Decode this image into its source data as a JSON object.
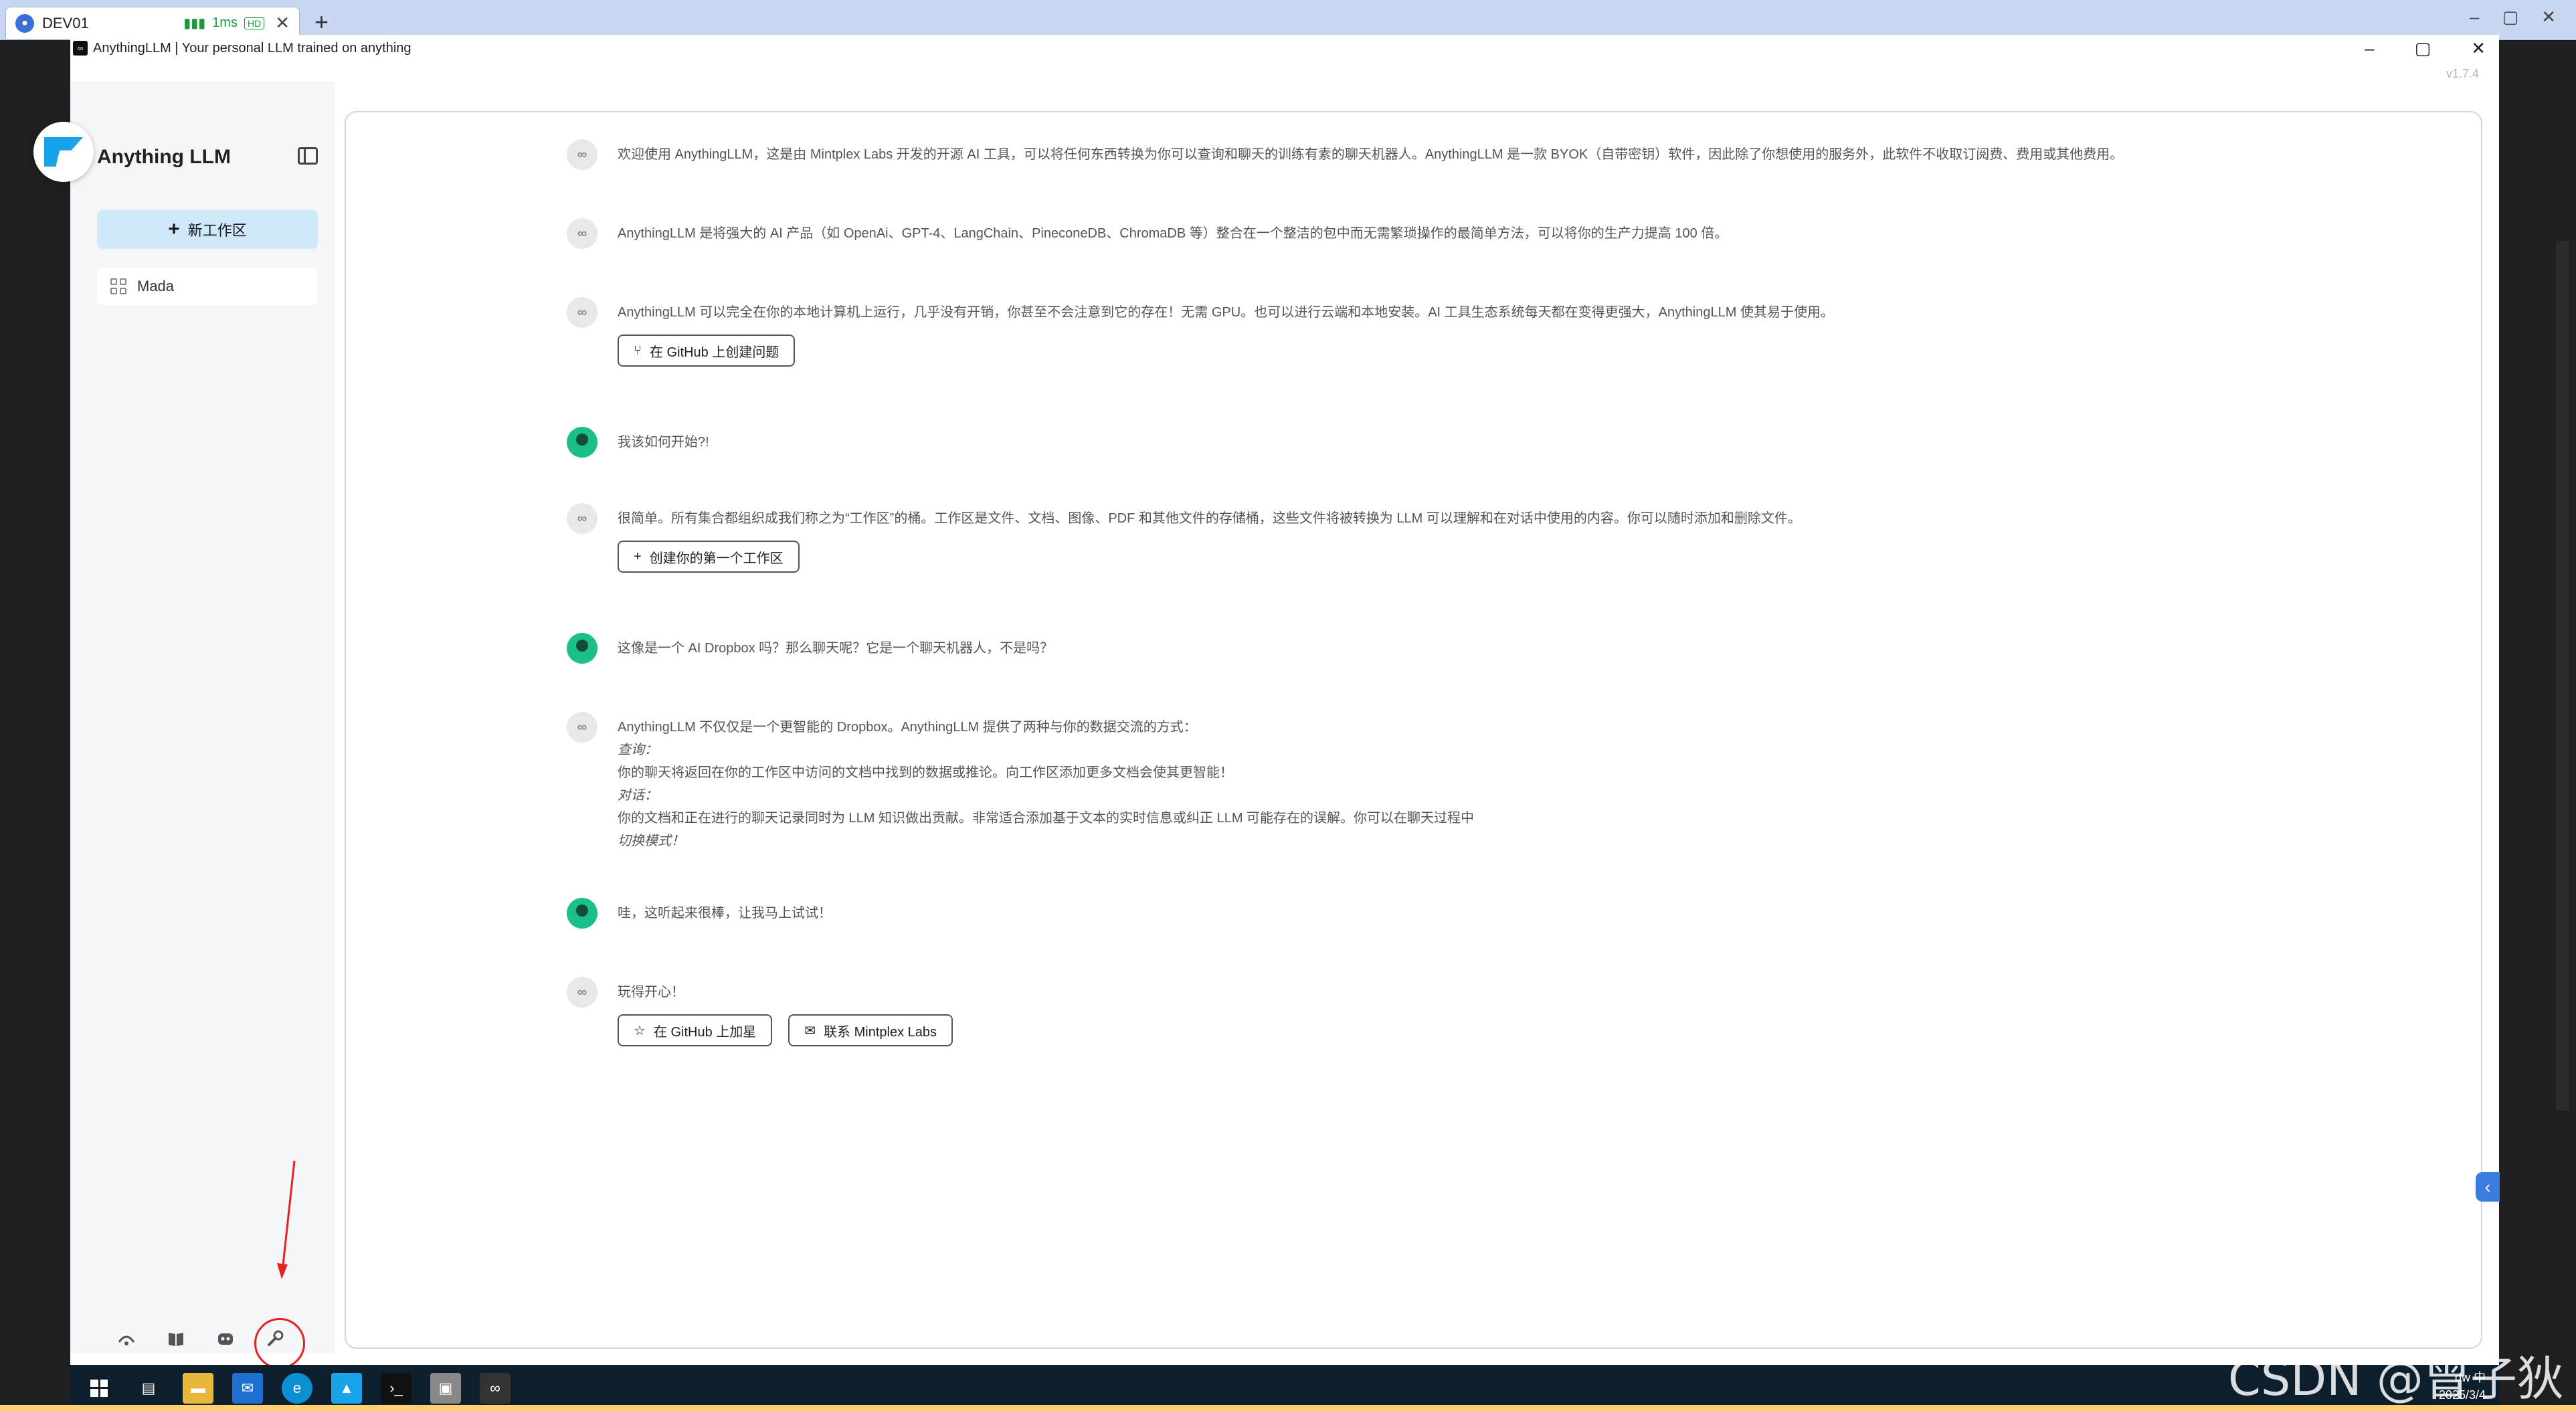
{
  "remote": {
    "tab_label": "DEV01",
    "latency": "1ms",
    "quality": "HD",
    "close": "✕",
    "new_tab": "+"
  },
  "window": {
    "title": "AnythingLLM | Your personal LLM trained on anything",
    "version": "v1.7.4",
    "min": "–",
    "max": "▢",
    "close": "✕"
  },
  "sidebar": {
    "brand": "Anything LLM",
    "new_workspace": "新工作区",
    "workspaces": [
      {
        "label": "Mada"
      }
    ],
    "footer_icons": [
      "community-hub-icon",
      "docs-book-icon",
      "discord-icon",
      "settings-wrench-icon"
    ]
  },
  "chat": {
    "bot_avatar": "∞",
    "messages": [
      {
        "role": "bot",
        "text": "欢迎使用 AnythingLLM，这是由 Mintplex Labs 开发的开源 AI 工具，可以将任何东西转换为你可以查询和聊天的训练有素的聊天机器人。AnythingLLM 是一款 BYOK（自带密钥）软件，因此除了你想使用的服务外，此软件不收取订阅费、费用或其他费用。"
      },
      {
        "role": "bot",
        "text": "AnythingLLM 是将强大的 AI 产品（如 OpenAi、GPT-4、LangChain、PineconeDB、ChromaDB 等）整合在一个整洁的包中而无需繁琐操作的最简单方法，可以将你的生产力提高 100 倍。"
      },
      {
        "role": "bot",
        "text": "AnythingLLM 可以完全在你的本地计算机上运行，几乎没有开销，你甚至不会注意到它的存在！无需 GPU。也可以进行云端和本地安装。AI 工具生态系统每天都在变得更强大，AnythingLLM 使其易于使用。",
        "button": "在 GitHub 上创建问题"
      },
      {
        "role": "user",
        "text": "我该如何开始?!"
      },
      {
        "role": "bot",
        "text": "很简单。所有集合都组织成我们称之为“工作区”的桶。工作区是文件、文档、图像、PDF 和其他文件的存储桶，这些文件将被转换为 LLM 可以理解和在对话中使用的内容。你可以随时添加和删除文件。",
        "button": "创建你的第一个工作区"
      },
      {
        "role": "user",
        "text": "这像是一个 AI Dropbox 吗？那么聊天呢？它是一个聊天机器人，不是吗？"
      },
      {
        "role": "bot",
        "lines": [
          "AnythingLLM 不仅仅是一个更智能的 Dropbox。AnythingLLM 提供了两种与你的数据交流的方式：",
          "查询：",
          "你的聊天将返回在你的工作区中访问的文档中找到的数据或推论。向工作区添加更多文档会使其更智能！",
          "对话：",
          "你的文档和正在进行的聊天记录同时为 LLM 知识做出贡献。非常适合添加基于文本的实时信息或纠正 LLM 可能存在的误解。你可以在聊天过程中",
          "切换模式！"
        ]
      },
      {
        "role": "user",
        "text": "哇，这听起来很棒，让我马上试试！"
      },
      {
        "role": "bot",
        "text": "玩得开心！",
        "buttons": [
          "在 GitHub 上加星",
          "联系 Mintplex Labs"
        ]
      }
    ]
  },
  "taskbar": {
    "tray_line1": "dw 中",
    "date": "2025/3/4"
  },
  "watermark": "CSDN @曾子狄",
  "colors": {
    "accent": "#19a3e8",
    "new_ws_bg": "#cfe9fb",
    "user_avatar": "#1bbf8c",
    "highlight": "#e52222"
  }
}
